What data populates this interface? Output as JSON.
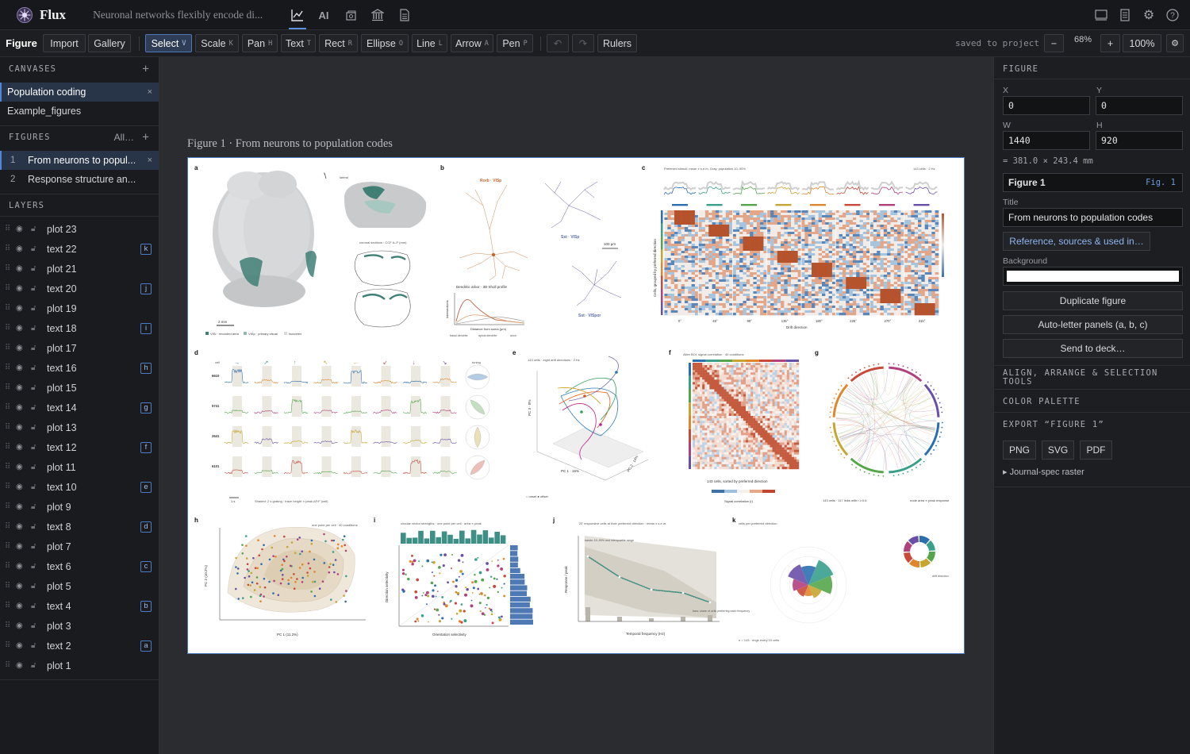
{
  "app": {
    "name": "Flux",
    "document_title": "Neuronal networks flexibly encode di..."
  },
  "top_icons": [
    "chart-icon",
    "ai-icon",
    "gallery-icon",
    "library-icon",
    "document-icon",
    "panel-icon",
    "notes-icon",
    "gear-icon",
    "help-icon"
  ],
  "toolbar": {
    "modes": [
      "Figure",
      "Import",
      "Gallery"
    ],
    "tools": [
      {
        "label": "Select",
        "key": "V"
      },
      {
        "label": "Scale",
        "key": "K"
      },
      {
        "label": "Pan",
        "key": "H"
      },
      {
        "label": "Text",
        "key": "T"
      },
      {
        "label": "Rect",
        "key": "R"
      },
      {
        "label": "Ellipse",
        "key": "O"
      },
      {
        "label": "Line",
        "key": "L"
      },
      {
        "label": "Arrow",
        "key": "A"
      },
      {
        "label": "Pen",
        "key": "P"
      }
    ],
    "undo": "↶",
    "redo": "↷",
    "rulers": "Rulers",
    "saved_status": "saved to project",
    "zoom_out": "−",
    "zoom_level": "68%",
    "zoom_in": "+",
    "zoom_reset": "100%",
    "settings": "⚙"
  },
  "canvases": {
    "header": "CANVASES",
    "add": "+",
    "items": [
      {
        "label": "Population coding",
        "close": "×"
      },
      {
        "label": "Example_figures"
      }
    ]
  },
  "figures": {
    "header": "FIGURES",
    "filter": "All…",
    "add": "+",
    "items": [
      {
        "num": "1",
        "label": "From neurons to popul...",
        "close": "×"
      },
      {
        "num": "2",
        "label": "Response structure an..."
      }
    ]
  },
  "layers": {
    "header": "LAYERS",
    "items": [
      {
        "name": "plot 23",
        "badge": ""
      },
      {
        "name": "text 22",
        "badge": "k"
      },
      {
        "name": "plot 21",
        "badge": ""
      },
      {
        "name": "text 20",
        "badge": "j"
      },
      {
        "name": "plot 19",
        "badge": ""
      },
      {
        "name": "text 18",
        "badge": "i"
      },
      {
        "name": "plot 17",
        "badge": ""
      },
      {
        "name": "text 16",
        "badge": "h"
      },
      {
        "name": "plot 15",
        "badge": ""
      },
      {
        "name": "text 14",
        "badge": "g"
      },
      {
        "name": "plot 13",
        "badge": ""
      },
      {
        "name": "text 12",
        "badge": "f"
      },
      {
        "name": "plot 11",
        "badge": ""
      },
      {
        "name": "text 10",
        "badge": "e"
      },
      {
        "name": "plot 9",
        "badge": ""
      },
      {
        "name": "text 8",
        "badge": "d"
      },
      {
        "name": "plot 7",
        "badge": ""
      },
      {
        "name": "text 6",
        "badge": "c"
      },
      {
        "name": "plot 5",
        "badge": ""
      },
      {
        "name": "text 4",
        "badge": "b"
      },
      {
        "name": "plot 3",
        "badge": ""
      },
      {
        "name": "text 2",
        "badge": "a"
      },
      {
        "name": "plot 1",
        "badge": ""
      }
    ]
  },
  "canvas": {
    "figure_title": "Figure 1 · From neurons to population codes",
    "panel_letters": [
      "a",
      "b",
      "c",
      "d",
      "e",
      "f",
      "g",
      "h",
      "i",
      "j",
      "k"
    ],
    "panels": {
      "a": {
        "scale": "2 mm",
        "legend": [
          "VISl · recorded area",
          "VISp · primary visual",
          "Isocortex"
        ],
        "top_label": "lateral",
        "mid_label": "coronal sections · CCF A–P (mm)"
      },
      "b": {
        "neuron1": "Rorb · VISp",
        "neuron2": "Sst · VISp",
        "neuron3": "Sst · VISpor",
        "scale": "100 μm",
        "sholl": "Dendritic arbor · 3D Sholl profile",
        "xlabel": "Distance from soma (μm)",
        "ylabel": "Intersections",
        "legend": [
          "basal dendrite",
          "apical dendrite",
          "axon"
        ]
      },
      "c": {
        "title": "Preferred stimuli: mean ± s.e.m. Gray: population 10–90%",
        "meta": "143 cells · 2 Hz",
        "xlabel": "Drift direction",
        "ylabel": "Cells, grouped by preferred direction",
        "ticks": [
          "0°",
          "45°",
          "90°",
          "135°",
          "180°",
          "225°",
          "270°",
          "315°"
        ]
      },
      "d": {
        "ylabel": "cell",
        "tuning": "tuning",
        "cells": [
          "6610",
          "5741",
          "2641",
          "6101"
        ],
        "note": "Shaded: 2 s grating · trace height ∝ peak ΔF/F (cell)",
        "scale": "1 s"
      },
      "e": {
        "title": "143 cells · eight drift directions · 2 Hz",
        "xlabel": "PC 1 · 16%",
        "ylabel": "PC 3 · 8%",
        "zlabel": "PC 2 · 14%",
        "legend": "○ onset   ● offset"
      },
      "f": {
        "title": "Allen BOI: signal correlation · 40 conditions",
        "xlabel": "143 cells, sorted by preferred direction",
        "cbar": "Signal correlation (r)"
      },
      "g": {
        "note": "143 cells · 117 links with r ≥ 0.6",
        "note2": "node area ∝ peak response"
      },
      "h": {
        "title": "one point per cell · 40 conditions",
        "xlabel": "PC 1 (11.2%)",
        "ylabel": "PC 2 (10.2%)"
      },
      "i": {
        "title": "circular vector strengths · one point per cell · area ∝ peak",
        "xlabel": "Orientation selectivity",
        "ylabel": "Direction selectivity"
      },
      "j": {
        "title": "'20' responsive cells at their preferred direction · mean ± s.e.m.",
        "xlabel": "Temporal frequency (Hz)",
        "ylabel": "Response / peak",
        "note": "bands: 10–90% and interquartile range",
        "note2": "bars: share of cells preferring each frequency"
      },
      "k": {
        "title": "cells per preferred direction",
        "note": "n = 143 · rings every 10 cells",
        "inset": "drift direction"
      }
    }
  },
  "inspector": {
    "section": "FIGURE",
    "x_label": "X",
    "x_value": "0",
    "y_label": "Y",
    "y_value": "0",
    "w_label": "W",
    "w_value": "1440",
    "h_label": "H",
    "h_value": "920",
    "size_mm": "= 381.0 × 243.4 mm",
    "name": "Figure 1",
    "tag": "Fig. 1",
    "title_label": "Title",
    "title_value": "From neurons to population codes",
    "reference_button": "Reference, sources & used in…",
    "background_label": "Background",
    "background_color": "#ffffff",
    "buttons": [
      "Duplicate figure",
      "Auto-letter panels (a, b, c)",
      "Send to deck…"
    ],
    "align_section": "ALIGN, ARRANGE & SELECTION TOOLS",
    "palette_section": "COLOR PALETTE",
    "export_section": "EXPORT “FIGURE 1”",
    "export_formats": [
      "PNG",
      "SVG",
      "PDF"
    ],
    "raster": "▸ Journal-spec raster"
  },
  "colors": {
    "accent": "#4f86d8",
    "teal": "#2a7e72",
    "warm": "#b5532d",
    "cool": "#3d6fa8"
  }
}
